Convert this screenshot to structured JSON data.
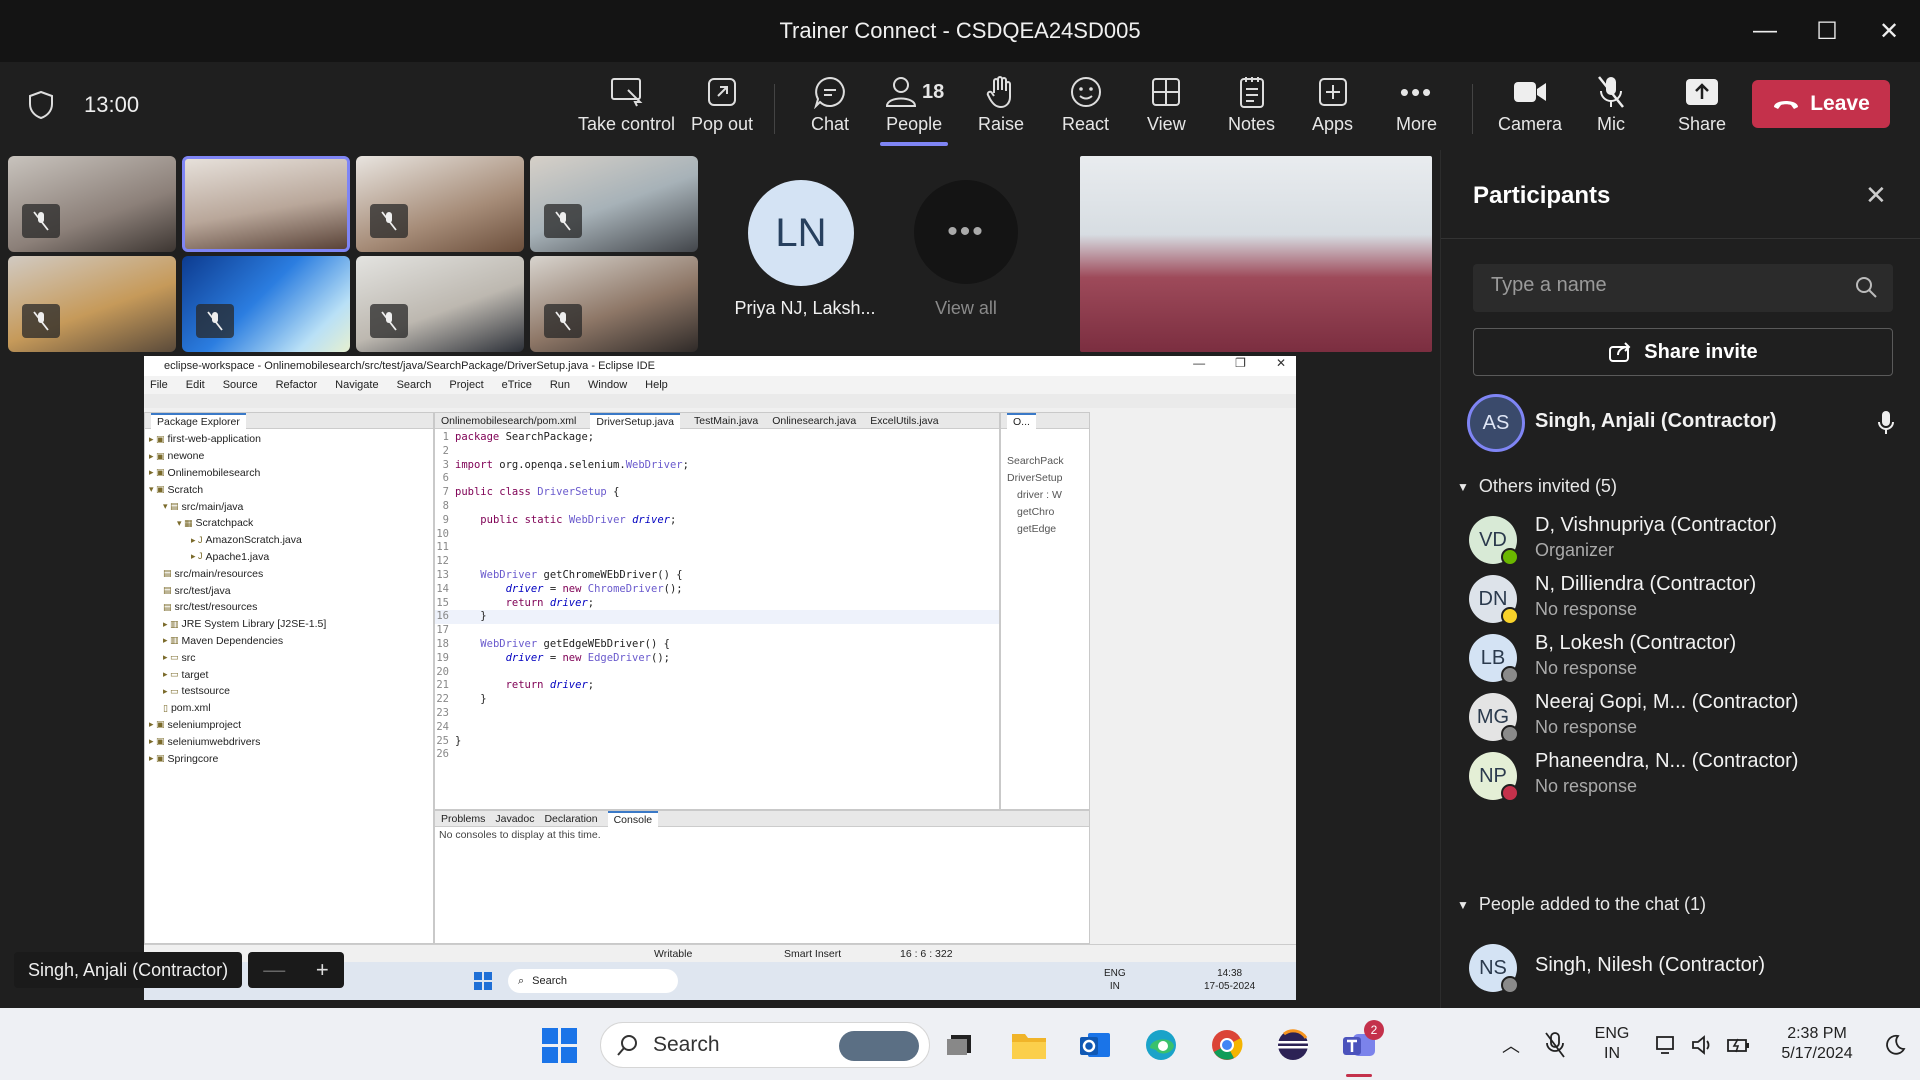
{
  "window": {
    "title": "Trainer Connect - CSDQEA24SD005",
    "minimize": "—",
    "maximize": "☐",
    "close": "✕"
  },
  "toolbar": {
    "timer": "13:00",
    "take_control": "Take control",
    "pop_out": "Pop out",
    "chat": "Chat",
    "people": "People",
    "people_count": "18",
    "raise": "Raise",
    "react": "React",
    "view": "View",
    "notes": "Notes",
    "apps": "Apps",
    "more": "More",
    "camera": "Camera",
    "mic": "Mic",
    "share": "Share",
    "leave": "Leave"
  },
  "gallery": {
    "avatar_initials": "LN",
    "avatar_name": "Priya NJ, Laksh...",
    "view_all": "View all",
    "view_all_dots": "•••"
  },
  "eclipse": {
    "title": "eclipse-workspace - Onlinemobilesearch/src/test/java/SearchPackage/DriverSetup.java - Eclipse IDE",
    "menu": [
      "File",
      "Edit",
      "Source",
      "Refactor",
      "Navigate",
      "Search",
      "Project",
      "eTrice",
      "Run",
      "Window",
      "Help"
    ],
    "explorer_tab": "Package Explorer",
    "tree": [
      "first-web-application",
      "newone",
      "Onlinemobilesearch",
      "Scratch",
      "src/main/java",
      "Scratchpack",
      "AmazonScratch.java",
      "Apache1.java",
      "src/main/resources",
      "src/test/java",
      "src/test/resources",
      "JRE System Library [J2SE-1.5]",
      "Maven Dependencies",
      "src",
      "target",
      "testsource",
      "pom.xml",
      "seleniumproject",
      "seleniumwebdrivers",
      "Springcore"
    ],
    "editor_tabs": [
      "Onlinemobilesearch/pom.xml",
      "DriverSetup.java",
      "TestMain.java",
      "Onlinesearch.java",
      "ExcelUtils.java"
    ],
    "code_lines": [
      {
        "n": "1",
        "t": "package SearchPackage;"
      },
      {
        "n": "2",
        "t": ""
      },
      {
        "n": "3",
        "t": "import org.openqa.selenium.WebDriver;"
      },
      {
        "n": "6",
        "t": ""
      },
      {
        "n": "7",
        "t": "public class DriverSetup {"
      },
      {
        "n": "8",
        "t": ""
      },
      {
        "n": "9",
        "t": "    public static WebDriver driver;"
      },
      {
        "n": "10",
        "t": ""
      },
      {
        "n": "11",
        "t": ""
      },
      {
        "n": "12",
        "t": ""
      },
      {
        "n": "13",
        "t": "    WebDriver getChromeWEbDriver() {"
      },
      {
        "n": "14",
        "t": "        driver = new ChromeDriver();"
      },
      {
        "n": "15",
        "t": "        return driver;"
      },
      {
        "n": "16",
        "t": "    }"
      },
      {
        "n": "17",
        "t": ""
      },
      {
        "n": "18",
        "t": "    WebDriver getEdgeWEbDriver() {"
      },
      {
        "n": "19",
        "t": "        driver = new EdgeDriver();"
      },
      {
        "n": "20",
        "t": ""
      },
      {
        "n": "21",
        "t": "        return driver;"
      },
      {
        "n": "22",
        "t": "    }"
      },
      {
        "n": "23",
        "t": ""
      },
      {
        "n": "24",
        "t": ""
      },
      {
        "n": "25",
        "t": "}"
      },
      {
        "n": "26",
        "t": ""
      }
    ],
    "outline_tab": "O...",
    "outline_items": [
      "SearchPack",
      "DriverSetup",
      "driver : W",
      "getChro",
      "getEdge"
    ],
    "bottom_tabs": [
      "Problems",
      "Javadoc",
      "Declaration",
      "Console"
    ],
    "console_msg": "No consoles to display at this time.",
    "status_writable": "Writable",
    "status_insert": "Smart Insert",
    "status_pos": "16 : 6 : 322",
    "inner_search": "Search",
    "inner_lang": "ENG",
    "inner_region": "IN",
    "inner_time": "14:38",
    "inner_date": "17-05-2024"
  },
  "speaker": {
    "name": "Singh, Anjali (Contractor)",
    "zoom_out": "—",
    "zoom_in": "+"
  },
  "panel": {
    "title": "Participants",
    "search_placeholder": "Type a name",
    "share_invite": "Share invite",
    "current": {
      "initials": "AS",
      "name": "Singh, Anjali (Contractor)"
    },
    "others_header": "Others invited (5)",
    "others": [
      {
        "initials": "VD",
        "name": "D, Vishnupriya (Contractor)",
        "sub": "Organizer",
        "color": "#d8ead6",
        "status": "#6bb700"
      },
      {
        "initials": "DN",
        "name": "N, Dilliendra (Contractor)",
        "sub": "No response",
        "color": "#dde3ea",
        "status": "#f8d22a"
      },
      {
        "initials": "LB",
        "name": "B, Lokesh (Contractor)",
        "sub": "No response",
        "color": "#d4e3f4",
        "status": "#8a8a8a"
      },
      {
        "initials": "MG",
        "name": "Neeraj Gopi, M... (Contractor)",
        "sub": "No response",
        "color": "#e4e4e4",
        "status": "#8a8a8a"
      },
      {
        "initials": "NP",
        "name": "Phaneendra, N... (Contractor)",
        "sub": "No response",
        "color": "#e4efd6",
        "status": "#c4314b"
      }
    ],
    "added_header": "People added to the chat (1)",
    "added": [
      {
        "initials": "NS",
        "name": "Singh, Nilesh (Contractor)",
        "color": "#d4e3f4"
      }
    ]
  },
  "taskbar": {
    "search": "Search",
    "lang": "ENG",
    "region": "IN",
    "time": "2:38 PM",
    "date": "5/17/2024",
    "teams_badge": "2"
  }
}
